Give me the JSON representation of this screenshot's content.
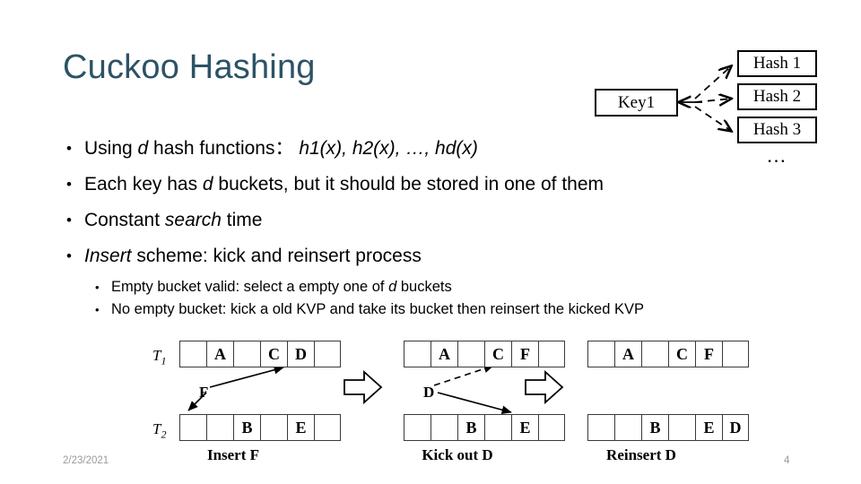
{
  "slide": {
    "title": "Cuckoo Hashing",
    "title_color": "#2d5266",
    "background": "#ffffff"
  },
  "bullets": [
    {
      "level": 1,
      "marker": "•",
      "segments": [
        {
          "text": "Using ",
          "italic": false
        },
        {
          "text": "d",
          "italic": true
        },
        {
          "text": "  hash functions：  ",
          "italic": false
        },
        {
          "text": "h1(x), h2(x), …, hd(x)",
          "italic": true
        }
      ]
    },
    {
      "level": 1,
      "marker": "•",
      "segments": [
        {
          "text": "Each key  has ",
          "italic": false
        },
        {
          "text": "d",
          "italic": true
        },
        {
          "text": "  buckets, but it should be stored in one of them",
          "italic": false
        }
      ]
    },
    {
      "level": 1,
      "marker": "•",
      "segments": [
        {
          "text": "Constant ",
          "italic": false
        },
        {
          "text": "search",
          "italic": true
        },
        {
          "text": " time",
          "italic": false
        }
      ]
    },
    {
      "level": 1,
      "marker": "•",
      "segments": [
        {
          "text": "Insert",
          "italic": true
        },
        {
          "text": " scheme: kick and reinsert process",
          "italic": false
        }
      ]
    },
    {
      "level": 2,
      "marker": "•",
      "segments": [
        {
          "text": "Empty bucket valid:  select a empty one of ",
          "italic": false
        },
        {
          "text": "d",
          "italic": true
        },
        {
          "text": " buckets",
          "italic": false
        }
      ]
    },
    {
      "level": 2,
      "marker": "•",
      "segments": [
        {
          "text": "No empty bucket: kick a old KVP and take its bucket then reinsert the kicked KVP",
          "italic": false
        }
      ]
    }
  ],
  "hash_diagram": {
    "key_label": "Key1",
    "hash_labels": [
      "Hash 1",
      "Hash 2",
      "Hash 3"
    ],
    "ellipsis": "…",
    "arrow_style": "dashed"
  },
  "table_diagram": {
    "row_labels": {
      "top": "T",
      "top_sub": "1",
      "bottom": "T",
      "bottom_sub": "2"
    },
    "panels": [
      {
        "caption": "Insert F",
        "move_label": "F",
        "t1": [
          "",
          "A",
          "",
          "C",
          "D",
          ""
        ],
        "t2": [
          "",
          "",
          "B",
          "",
          "E",
          ""
        ]
      },
      {
        "caption": "Kick out D",
        "move_label": "D",
        "t1": [
          "",
          "A",
          "",
          "C",
          "F",
          ""
        ],
        "t2": [
          "",
          "",
          "B",
          "",
          "E",
          ""
        ]
      },
      {
        "caption": "Reinsert D",
        "move_label": "",
        "t1": [
          "",
          "A",
          "",
          "C",
          "F",
          ""
        ],
        "t2": [
          "",
          "",
          "B",
          "",
          "E",
          "D"
        ]
      }
    ]
  },
  "footer": {
    "date": "2/23/2021",
    "page_number": "4"
  }
}
